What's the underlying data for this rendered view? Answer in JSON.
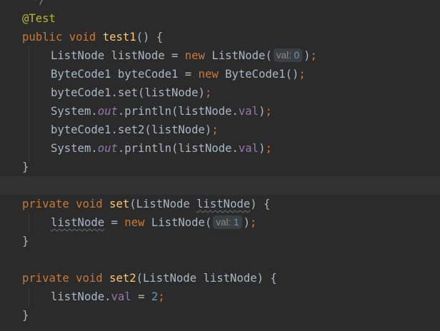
{
  "editor": {
    "language": "java",
    "colors": {
      "background": "#2b2b2b",
      "current_line": "#323232",
      "keyword": "#cc7832",
      "method": "#ffc66d",
      "annotation": "#bbb529",
      "number": "#6897bb",
      "field": "#9876aa",
      "text": "#a9b7c6",
      "comment": "#808080"
    },
    "lines": {
      "comment_end": "*/",
      "annotation": "@Test",
      "test1": {
        "kw_public": "public",
        "kw_void": "void",
        "name": "test1",
        "rest": "() {"
      },
      "l2": {
        "type": "ListNode",
        "var": "listNode",
        "eq": "=",
        "kw_new": "new",
        "ctor": "ListNode(",
        "hint_label": "val:",
        "hint_value": "0",
        "close": ")",
        "semi": ";"
      },
      "l3": {
        "type": "ByteCode1",
        "var": "byteCode1",
        "eq": "=",
        "kw_new": "new",
        "ctor": "ByteCode1()",
        "semi": ";"
      },
      "l4": {
        "text": "byteCode1.set(listNode)",
        "semi": ";"
      },
      "l5": {
        "prefix": "System.",
        "field_out": "out",
        "mid": ".println(listNode.",
        "field_val": "val",
        "close": ")",
        "semi": ";"
      },
      "l6": {
        "text": "byteCode1.set2(listNode)",
        "semi": ";"
      },
      "l7": {
        "prefix": "System.",
        "field_out": "out",
        "mid": ".println(listNode.",
        "field_val": "val",
        "close": ")",
        "semi": ";"
      },
      "close1": "}",
      "set": {
        "kw_private": "private",
        "kw_void": "void",
        "name": "set",
        "open": "(ListNode ",
        "param": "listNode",
        "rest": ") {"
      },
      "set_body": {
        "var": "listNode",
        "eq": "=",
        "kw_new": "new",
        "ctor": "ListNode(",
        "hint_label": "val:",
        "hint_value": "1",
        "close": ")",
        "semi": ";"
      },
      "close2": "}",
      "set2": {
        "kw_private": "private",
        "kw_void": "void",
        "name": "set2",
        "rest": "(ListNode listNode) {"
      },
      "set2_body": {
        "prefix": "listNode.",
        "field_val": "val",
        "eq": "=",
        "value": "2",
        "semi": ";"
      },
      "close3": "}"
    }
  }
}
